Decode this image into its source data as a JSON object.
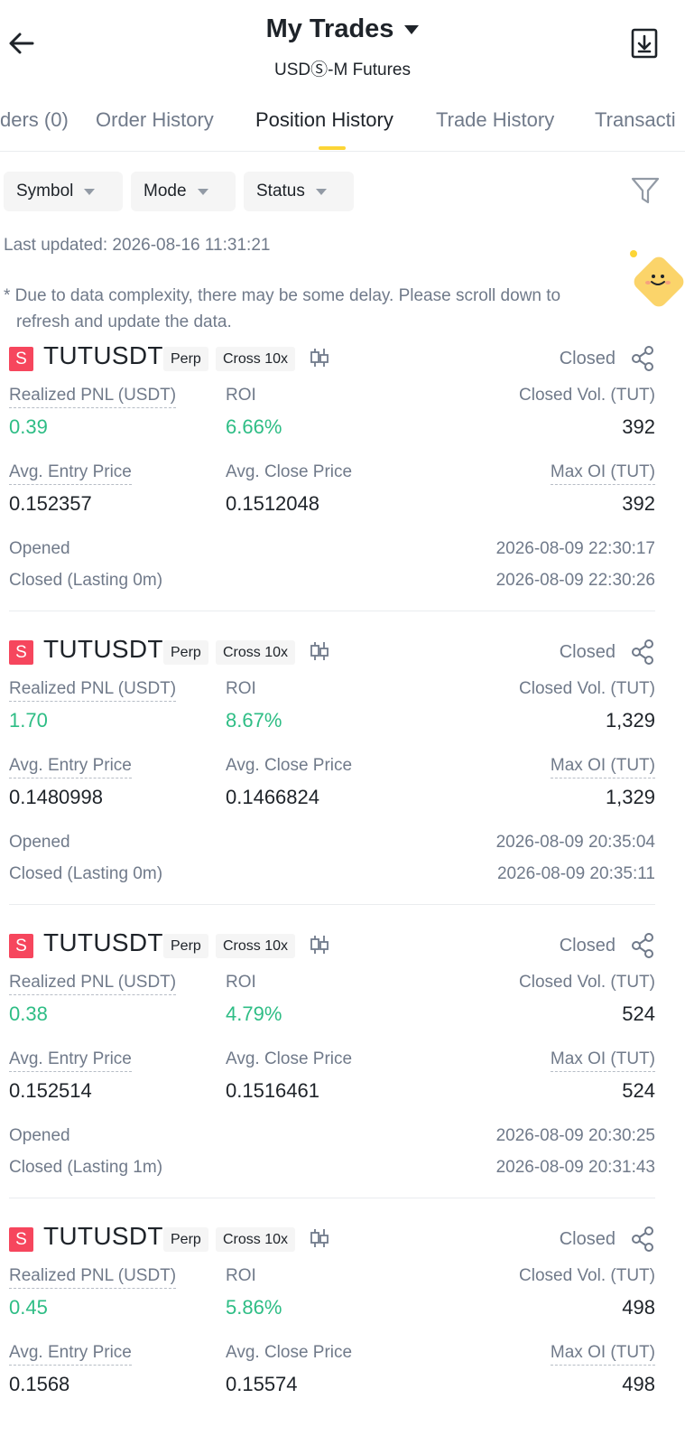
{
  "header": {
    "title": "My Trades",
    "subtitle": "USDⓈ-M Futures"
  },
  "tabs": [
    {
      "label": "ders (0)"
    },
    {
      "label": "Order History"
    },
    {
      "label": "Position History"
    },
    {
      "label": "Trade History"
    },
    {
      "label": "Transacti"
    }
  ],
  "filters": [
    {
      "label": "Symbol"
    },
    {
      "label": "Mode"
    },
    {
      "label": "Status"
    }
  ],
  "last_updated": "Last updated: 2026-08-16 11:31:21",
  "notice": {
    "line1": "* Due to data complexity, there may be some delay. Please scroll down to",
    "line2": "refresh and update the data."
  },
  "labels": {
    "realized_pnl": "Realized PNL (USDT)",
    "roi": "ROI",
    "closed_vol": "Closed Vol. (TUT)",
    "avg_entry": "Avg. Entry Price",
    "avg_close": "Avg. Close Price",
    "max_oi": "Max OI (TUT)",
    "opened": "Opened"
  },
  "positions": [
    {
      "side": "S",
      "symbol": "TUTUSDT",
      "contract": "Perp",
      "margin": "Cross 10x",
      "status": "Closed",
      "realized_pnl": "0.39",
      "roi": "6.66%",
      "closed_vol": "392",
      "avg_entry": "0.152357",
      "avg_close": "0.1512048",
      "max_oi": "392",
      "opened_time": "2026-08-09 22:30:17",
      "closed_label": "Closed (Lasting 0m)",
      "closed_time": "2026-08-09 22:30:26"
    },
    {
      "side": "S",
      "symbol": "TUTUSDT",
      "contract": "Perp",
      "margin": "Cross 10x",
      "status": "Closed",
      "realized_pnl": "1.70",
      "roi": "8.67%",
      "closed_vol": "1,329",
      "avg_entry": "0.1480998",
      "avg_close": "0.1466824",
      "max_oi": "1,329",
      "opened_time": "2026-08-09 20:35:04",
      "closed_label": "Closed (Lasting 0m)",
      "closed_time": "2026-08-09 20:35:11"
    },
    {
      "side": "S",
      "symbol": "TUTUSDT",
      "contract": "Perp",
      "margin": "Cross 10x",
      "status": "Closed",
      "realized_pnl": "0.38",
      "roi": "4.79%",
      "closed_vol": "524",
      "avg_entry": "0.152514",
      "avg_close": "0.1516461",
      "max_oi": "524",
      "opened_time": "2026-08-09 20:30:25",
      "closed_label": "Closed (Lasting 1m)",
      "closed_time": "2026-08-09 20:31:43"
    },
    {
      "side": "S",
      "symbol": "TUTUSDT",
      "contract": "Perp",
      "margin": "Cross 10x",
      "status": "Closed",
      "realized_pnl": "0.45",
      "roi": "5.86%",
      "closed_vol": "498",
      "avg_entry": "0.1568",
      "avg_close": "0.15574",
      "max_oi": "498"
    }
  ],
  "colors": {
    "positive": "#2ebd85",
    "short_badge": "#f6465d",
    "tab_indicator": "#fcd535"
  }
}
